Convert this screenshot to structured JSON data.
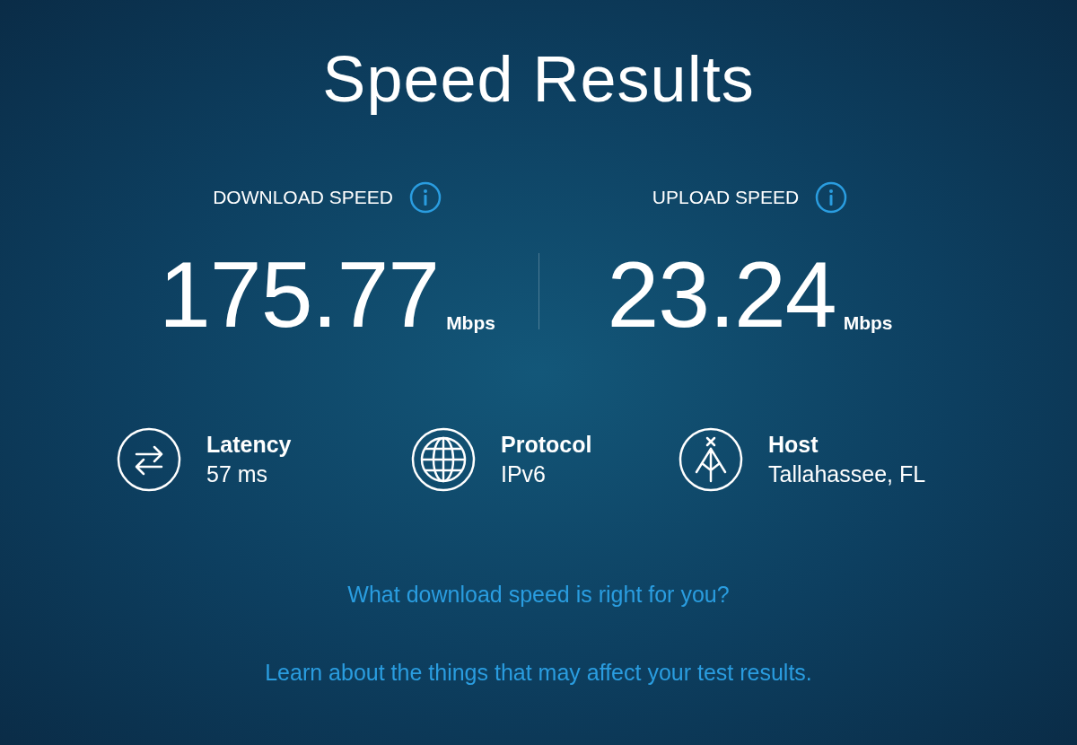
{
  "title": "Speed Results",
  "speeds": [
    {
      "label": "DOWNLOAD SPEED",
      "value": "175.77",
      "unit": "Mbps"
    },
    {
      "label": "UPLOAD SPEED",
      "value": "23.24",
      "unit": "Mbps"
    }
  ],
  "metrics": [
    {
      "kind": "latency",
      "label": "Latency",
      "value": "57 ms"
    },
    {
      "kind": "protocol",
      "label": "Protocol",
      "value": "IPv6"
    },
    {
      "kind": "host",
      "label": "Host",
      "value": "Tallahassee, FL"
    }
  ],
  "links": [
    "What download speed is right for you?",
    "Learn about the things that may affect your test results."
  ]
}
